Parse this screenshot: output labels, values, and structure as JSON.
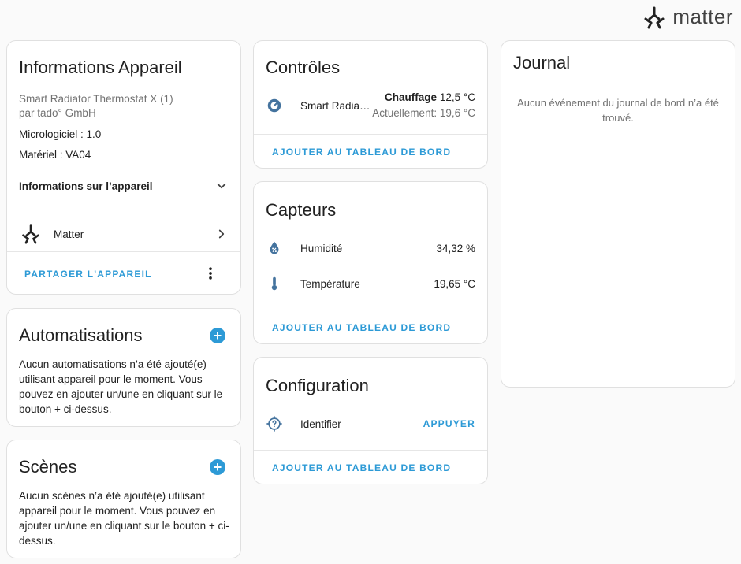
{
  "brand": {
    "name": "matter"
  },
  "device_info": {
    "title": "Informations Appareil",
    "model": "Smart Radiator Thermostat X (1)",
    "manufacturer": "par tado° GmbH",
    "firmware": "Micrologiciel : 1.0",
    "hardware": "Matériel : VA04",
    "expander_label": "Informations sur l’appareil",
    "integration": "Matter",
    "share_button": "PARTAGER L'APPAREIL"
  },
  "automations": {
    "title": "Automatisations",
    "empty_text": "Aucun automatisations n’a été ajouté(e) utilisant appareil pour le moment. Vous pouvez en ajouter un/une en cliquant sur le bouton + ci-dessus."
  },
  "scenes": {
    "title": "Scènes",
    "empty_text": "Aucun scènes n’a été ajouté(e) utilisant appareil pour le moment. Vous pouvez en ajouter un/une en cliquant sur le bouton + ci-dessus."
  },
  "controls": {
    "title": "Contrôles",
    "entity_name": "Smart Radia…",
    "mode_label": "Chauffage",
    "target_temp": "12,5 °C",
    "current_text": "Actuellement: 19,6 °C",
    "add_button": "AJOUTER AU TABLEAU DE BORD"
  },
  "sensors": {
    "title": "Capteurs",
    "items": [
      {
        "name": "Humidité",
        "value": "34,32 %"
      },
      {
        "name": "Température",
        "value": "19,65 °C"
      }
    ],
    "add_button": "AJOUTER AU TABLEAU DE BORD"
  },
  "configuration": {
    "title": "Configuration",
    "entity_name": "Identifier",
    "action_button": "APPUYER",
    "add_button": "AJOUTER AU TABLEAU DE BORD"
  },
  "logbook": {
    "title": "Journal",
    "empty_text": "Aucun événement du journal de bord n’a été trouvé."
  },
  "colors": {
    "accent": "#2d9ad6",
    "icon": "#44739e",
    "text": "#212121",
    "muted": "#727272"
  }
}
